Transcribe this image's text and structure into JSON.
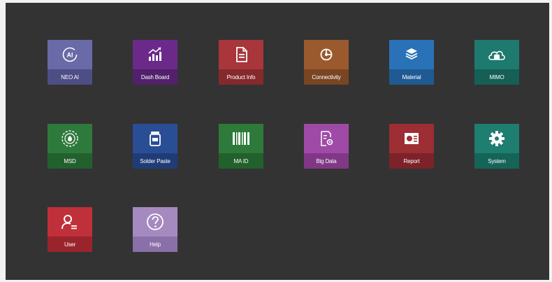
{
  "tiles": [
    {
      "label": "NEO AI",
      "icon": "ai-icon",
      "top_color": "#6a6aa8",
      "bottom_color": "#4e4e86"
    },
    {
      "label": "Dash Board",
      "icon": "chart-icon",
      "top_color": "#6b2a8a",
      "bottom_color": "#53206c"
    },
    {
      "label": "Product Info",
      "icon": "document-icon",
      "top_color": "#a8363a",
      "bottom_color": "#86292c"
    },
    {
      "label": "Connectivity",
      "icon": "connectivity-icon",
      "top_color": "#9a5a2e",
      "bottom_color": "#7a4522"
    },
    {
      "label": "Material",
      "icon": "layers-icon",
      "top_color": "#2a72b8",
      "bottom_color": "#1f5a92"
    },
    {
      "label": "MIMO",
      "icon": "cloud-database-icon",
      "top_color": "#1e7a6e",
      "bottom_color": "#155f55"
    },
    {
      "label": "MSD",
      "icon": "msd-gauge-icon",
      "top_color": "#2e7a3c",
      "bottom_color": "#22602e"
    },
    {
      "label": "Solder Paste",
      "icon": "solder-jar-icon",
      "top_color": "#2a4e96",
      "bottom_color": "#1f3c76"
    },
    {
      "label": "MA ID",
      "icon": "barcode-icon",
      "top_color": "#2e7a3a",
      "bottom_color": "#22602c"
    },
    {
      "label": "Big Data",
      "icon": "data-analysis-icon",
      "top_color": "#a04aa8",
      "bottom_color": "#803886"
    },
    {
      "label": "Report",
      "icon": "report-icon",
      "top_color": "#9c2e34",
      "bottom_color": "#7c2228"
    },
    {
      "label": "System",
      "icon": "gear-icon",
      "top_color": "#1e7e70",
      "bottom_color": "#156458"
    },
    {
      "label": "User",
      "icon": "user-icon",
      "top_color": "#c0303a",
      "bottom_color": "#9a242c"
    },
    {
      "label": "Help",
      "icon": "help-icon",
      "top_color": "#a58ac0",
      "bottom_color": "#8a70a8"
    }
  ]
}
